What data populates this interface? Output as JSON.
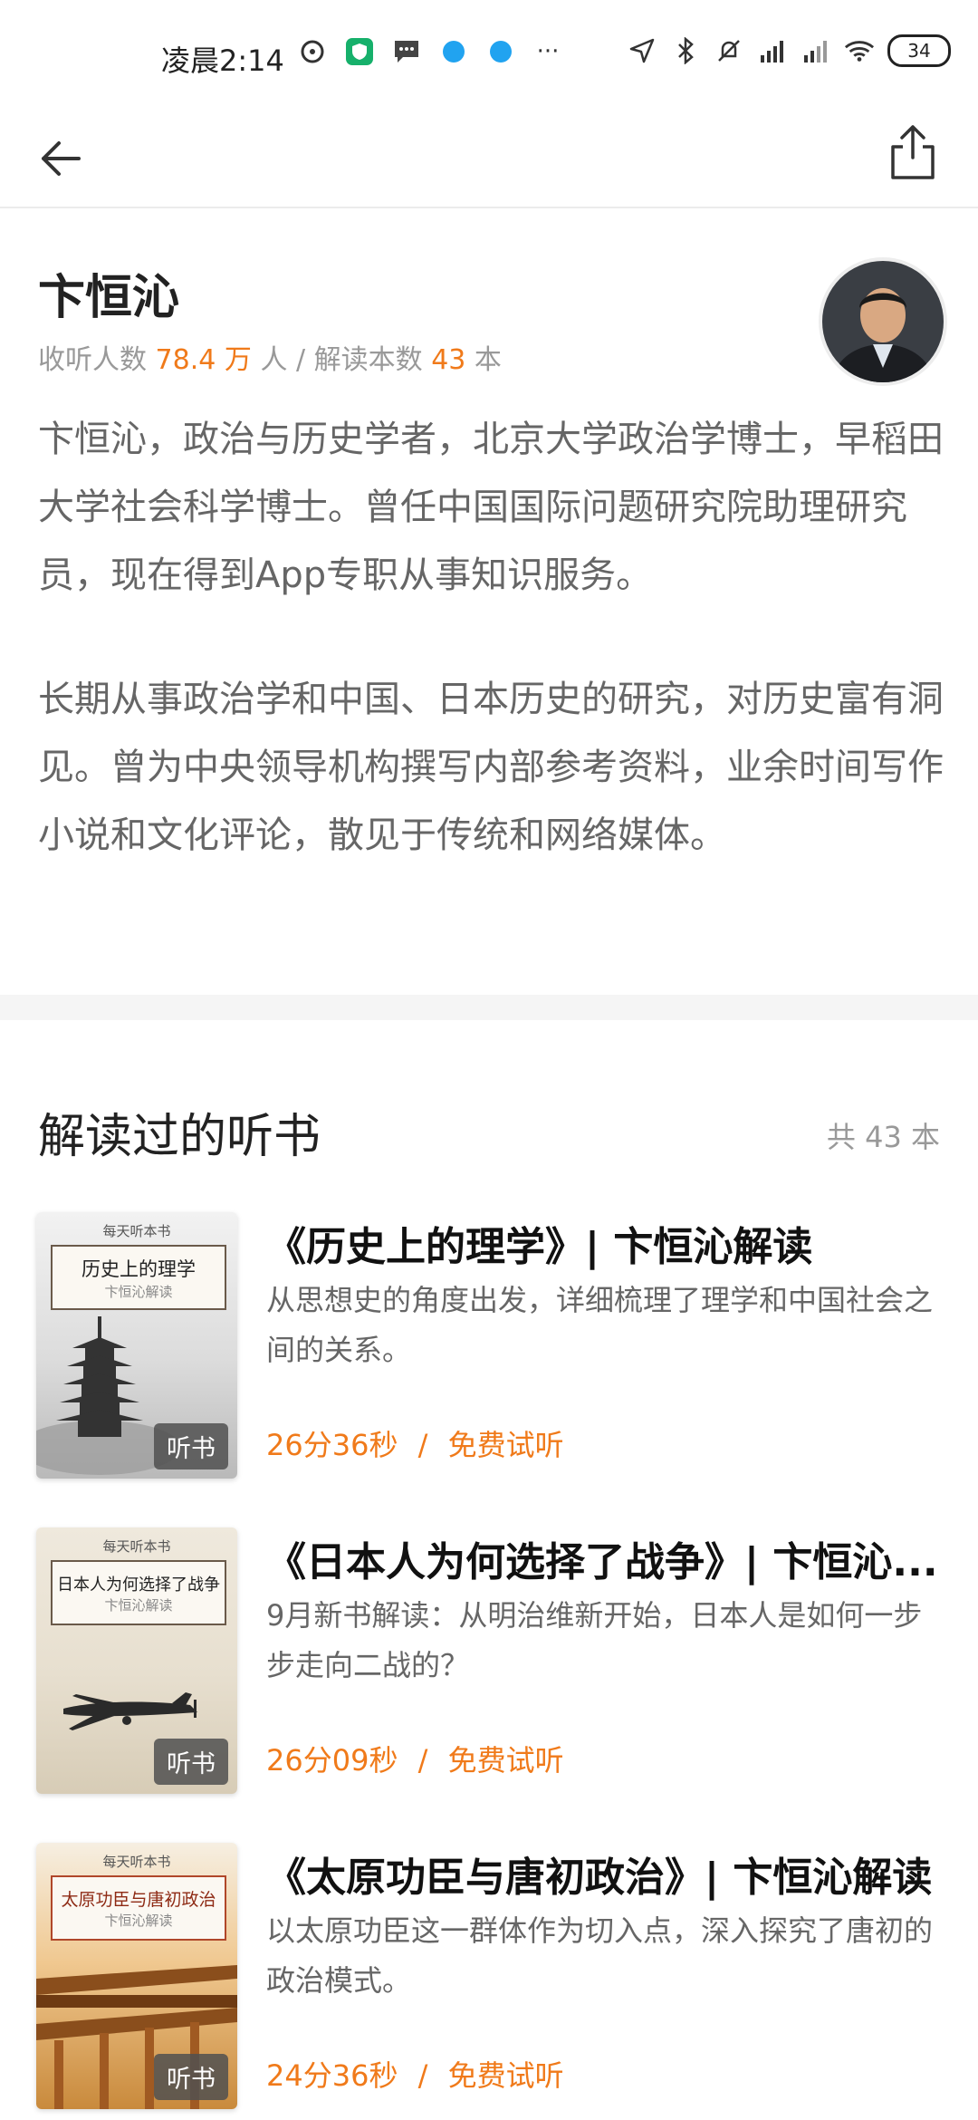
{
  "status_bar": {
    "time": "凌晨2:14",
    "battery": "34",
    "more": "···"
  },
  "author": {
    "name": "卞恒沁",
    "stats_listeners_label": "收听人数",
    "stats_listeners_value": "78.4 万",
    "stats_listeners_unit": "人 /",
    "stats_books_label": "解读本数",
    "stats_books_value": "43",
    "stats_books_unit": "本",
    "bio_p1": "卞恒沁，政治与历史学者，北京大学政治学博士，早稻田大学社会科学博士。曾任中国国际问题研究院助理研究员，现在得到App专职从事知识服务。",
    "bio_p2": "长期从事政治学和中国、日本历史的研究，对历史富有洞见。曾为中央领导机构撰写内部参考资料，业余时间写作小说和文化评论，散见于传统和网络媒体。"
  },
  "section": {
    "title": "解读过的听书",
    "count": "共 43 本"
  },
  "books": [
    {
      "title": "《历史上的理学》| 卞恒沁解读",
      "desc": "从思想史的角度出发，详细梳理了理学和中国社会之间的关系。",
      "duration": "26分36秒",
      "free": "免费试听",
      "cover_series": "每天听本书",
      "cover_title": "历史上的理学",
      "cover_author": "卞恒沁解读",
      "badge": "听书"
    },
    {
      "title": "《日本人为何选择了战争》| 卞恒沁...",
      "desc": "9月新书解读：从明治维新开始，日本人是如何一步步走向二战的？",
      "duration": "26分09秒",
      "free": "免费试听",
      "cover_series": "每天听本书",
      "cover_title": "日本人为何选择了战争",
      "cover_author": "卞恒沁解读",
      "badge": "听书"
    },
    {
      "title": "《太原功臣与唐初政治》| 卞恒沁解读",
      "desc": "以太原功臣这一群体作为切入点，深入探究了唐初的政治模式。",
      "duration": "24分36秒",
      "free": "免费试听",
      "cover_series": "每天听本书",
      "cover_title": "太原功臣与唐初政治",
      "cover_author": "卞恒沁解读",
      "badge": "听书"
    }
  ],
  "separator": "/"
}
